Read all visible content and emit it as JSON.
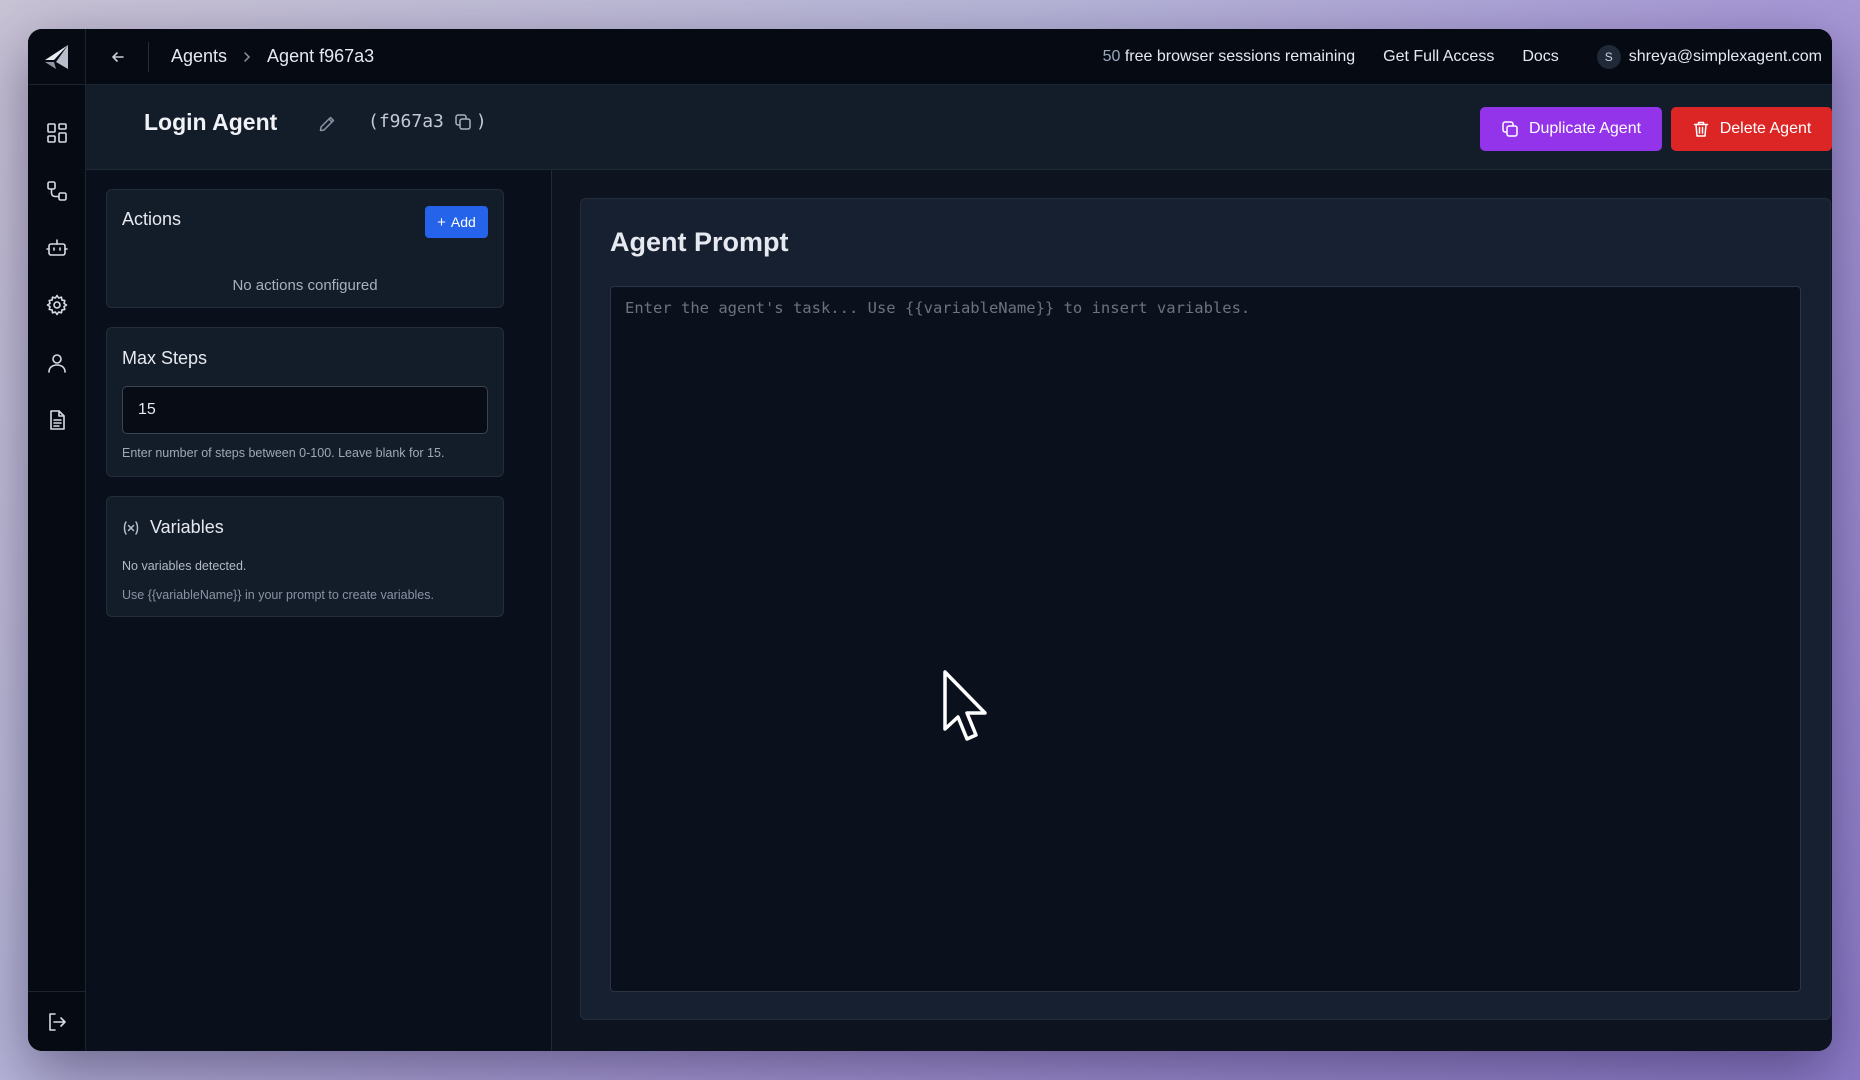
{
  "topbar": {
    "breadcrumb": {
      "parent": "Agents",
      "current": "Agent f967a3"
    },
    "sessions_count": "50",
    "sessions_text": " free browser sessions remaining",
    "get_full_access": "Get Full Access",
    "docs": "Docs",
    "avatar_initial": "S",
    "user_email": "shreya@simplexagent.com"
  },
  "sidebar": {
    "icons": [
      "dashboard-icon",
      "workflow-icon",
      "bot-icon",
      "gear-icon",
      "user-icon",
      "document-icon"
    ],
    "bottom_icon": "logout-icon"
  },
  "header": {
    "agent_name": "Login Agent",
    "agent_id": "f967a3",
    "id_open": "(",
    "id_close": ")",
    "duplicate_label": "Duplicate Agent",
    "delete_label": "Delete Agent"
  },
  "actions": {
    "title": "Actions",
    "add_label": "Add",
    "empty_text": "No actions configured"
  },
  "max_steps": {
    "title": "Max Steps",
    "value": "15",
    "help": "Enter number of steps between 0-100. Leave blank for 15."
  },
  "variables": {
    "title": "Variables",
    "empty_text": "No variables detected.",
    "hint": "Use {{variableName}} in your prompt to create variables."
  },
  "prompt": {
    "title": "Agent Prompt",
    "placeholder": "Enter the agent's task... Use {{variableName}} to insert variables.",
    "value": ""
  },
  "colors": {
    "accent_purple": "#9333ea",
    "danger_red": "#dc2626",
    "primary_blue": "#2563eb",
    "bg_dark": "#0b111c"
  }
}
